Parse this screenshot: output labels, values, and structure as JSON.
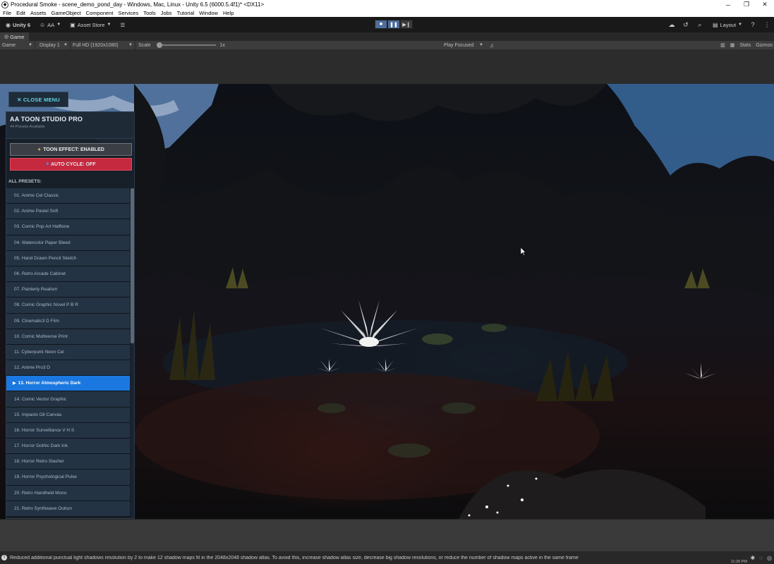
{
  "window": {
    "title": "Procedural Smoke - scene_demo_pond_day - Windows, Mac, Linux - Unity 6.5 (6000.5.4f1)* <DX11>",
    "minimize_icon": "minimize-icon",
    "maximize_icon": "maximize-icon",
    "close_icon": "close-icon"
  },
  "menubar": {
    "items": [
      "File",
      "Edit",
      "Assets",
      "GameObject",
      "Component",
      "Services",
      "Tools",
      "Jobs",
      "Tutorial",
      "Window",
      "Help"
    ]
  },
  "toolbar": {
    "unity_label": "Unity 6",
    "account_label": "AA",
    "asset_store_label": "Asset Store",
    "layout_label": "Layout"
  },
  "tabs": {
    "game_label": "Game"
  },
  "gamebar": {
    "view_label": "Game",
    "display_label": "Display 1",
    "resolution_label": "Full HD (1920x1080)",
    "scale_label": "Scale",
    "scale_value": "1x",
    "play_mode_label": "Play Focused",
    "stats_label": "Stats",
    "gizmos_label": "Gizmos"
  },
  "menu": {
    "close_label": "✕ CLOSE MENU",
    "title": "AA TOON STUDIO PRO",
    "subtitle": "44 Presets Available",
    "toon_effect_label": "TOON EFFECT: ENABLED",
    "auto_cycle_label": "AUTO CYCLE: OFF",
    "all_presets_label": "ALL PRESETS:",
    "active_index": 12,
    "presets": [
      "01. Anime Cel Classic",
      "02. Anime Pastel Soft",
      "03. Comic Pop Art Halftone",
      "04. Watercolor Paper Bleed",
      "05. Hand Drawn Pencil Sketch",
      "06. Retro Arcade Cabinet",
      "07. Painterly Realism",
      "08. Comic Graphic Novel P B R",
      "09. Cinematic3 D Film",
      "10. Comic Multiverse Print",
      "11. Cyberpunk Neon Cel",
      "12. Anime Pro3 D",
      "13. Horror Atmospheric Dark",
      "14. Comic Vector Graphic",
      "15. Impasto Oil Canvas",
      "16. Horror Surveillance V H S",
      "17. Horror Gothic Dark Ink",
      "18. Horror Retro Slasher",
      "19. Horror Psychological Pulse",
      "20. Retro Handheld Mono",
      "21. Retro Synthwave Outrun"
    ]
  },
  "status": {
    "message": "Reduced additional punctual light shadows resolution by 2 to make 12 shadow maps fit in the 2048x2048 shadow atlas. To avoid this, increase shadow atlas size, decrease big shadow resolutions, or reduce the number of shadow maps active in the same frame",
    "clock": "11:20 PM"
  },
  "colors": {
    "accent_blue": "#1b78e0",
    "auto_cycle_red": "#c4293f",
    "close_menu_text": "#5fd3e6"
  }
}
